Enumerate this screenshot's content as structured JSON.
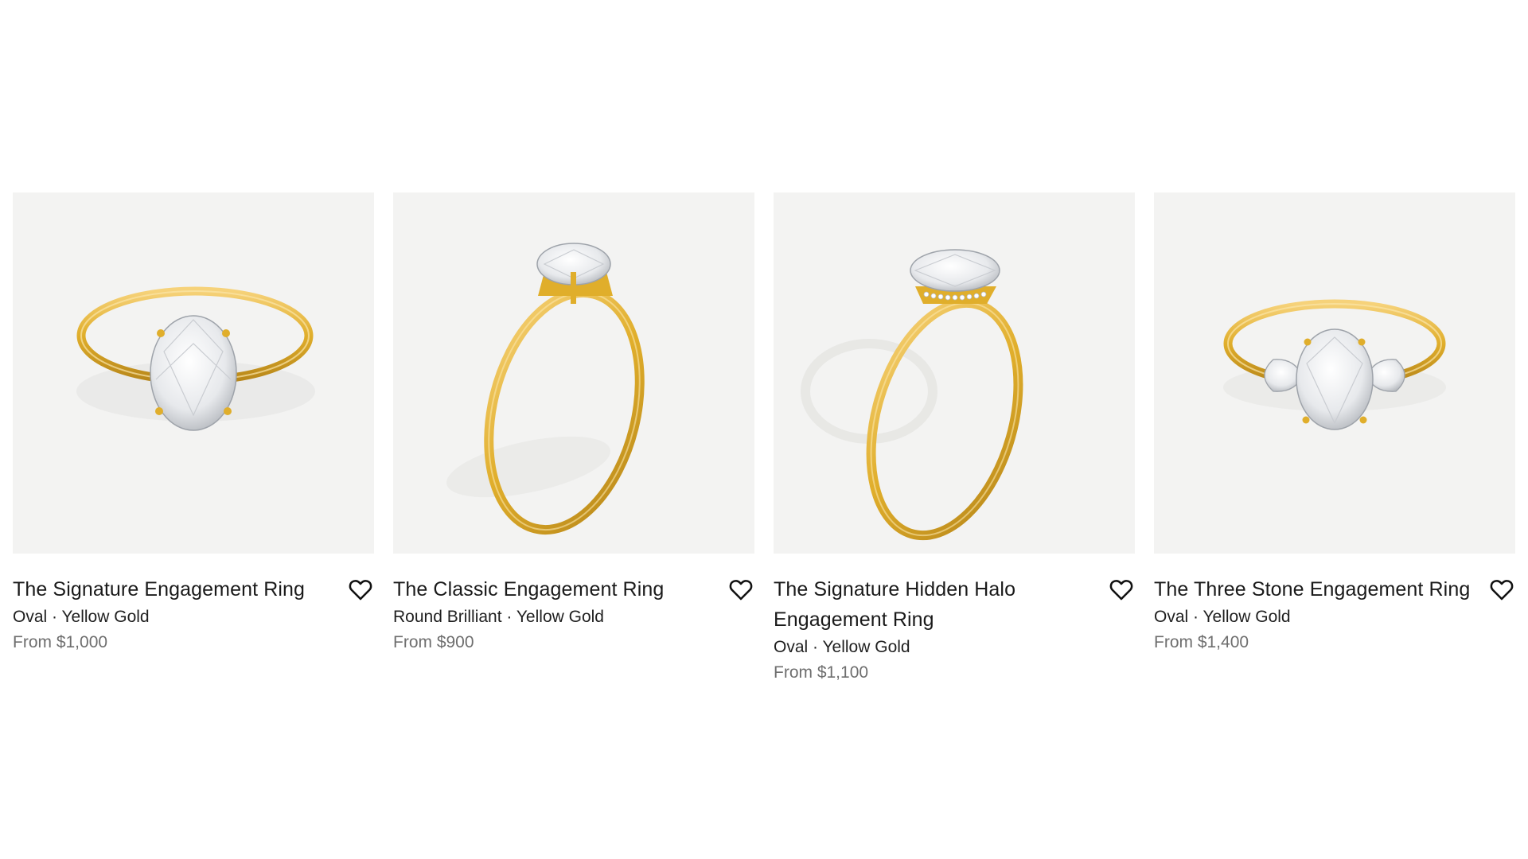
{
  "products": [
    {
      "name": "The Signature Engagement Ring",
      "variant": "Oval · Yellow Gold",
      "price": "From $1,000",
      "image_icon": "oval-solitaire-ring-image",
      "favorite_icon": "heart-outline-icon"
    },
    {
      "name": "The Classic Engagement Ring",
      "variant": "Round Brilliant · Yellow Gold",
      "price": "From $900",
      "image_icon": "round-solitaire-ring-image",
      "favorite_icon": "heart-outline-icon"
    },
    {
      "name": "The Signature Hidden Halo Engagement Ring",
      "variant": "Oval · Yellow Gold",
      "price": "From $1,100",
      "image_icon": "hidden-halo-ring-image",
      "favorite_icon": "heart-outline-icon"
    },
    {
      "name": "The Three Stone Engagement Ring",
      "variant": "Oval · Yellow Gold",
      "price": "From $1,400",
      "image_icon": "three-stone-ring-image",
      "favorite_icon": "heart-outline-icon"
    }
  ],
  "colors": {
    "gold": "#e3b52a",
    "image_background": "#f3f3f2",
    "price_text": "#6e6e6e"
  }
}
